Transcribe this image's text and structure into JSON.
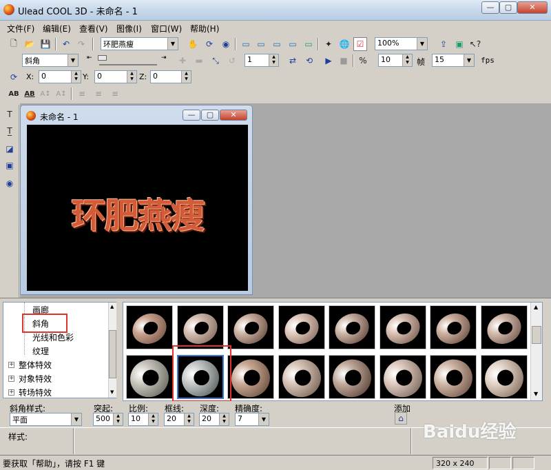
{
  "window": {
    "title": "Ulead COOL 3D - 未命名 - 1",
    "min": "—",
    "max": "▢",
    "close": "✕"
  },
  "menu": [
    "文件(F)",
    "编辑(E)",
    "查看(V)",
    "图像(I)",
    "窗口(W)",
    "帮助(H)"
  ],
  "toolbar1": {
    "object_combo": "环肥燕瘦",
    "zoom": "100%"
  },
  "toolbar2": {
    "effect_combo": "斜角",
    "frame_value": "1",
    "frame_count": "10",
    "frames_label": "帧",
    "fps_value": "15",
    "fps_label": "fps"
  },
  "toolbar3": {
    "x_label": "X:",
    "x_value": "0",
    "y_label": "Y:",
    "y_value": "0",
    "z_label": "Z:",
    "z_value": "0"
  },
  "document": {
    "title": "未命名 - 1",
    "scene_text": "环肥燕瘦"
  },
  "tree": {
    "items": [
      "画廊",
      "斜角",
      "光线和色彩",
      "纹理"
    ],
    "groups": [
      "整体特效",
      "对象特效",
      "转场特效"
    ],
    "selected": "斜角"
  },
  "gallery": {
    "rows": 2,
    "per_row": 8,
    "selected_row": 2,
    "selected_col": 2
  },
  "properties": {
    "bevel_style_label": "斜角样式:",
    "bevel_style_value": "平面",
    "protrude_label": "突起:",
    "protrude_value": "500",
    "ratio_label": "比例:",
    "ratio_value": "10",
    "border_label": "框线:",
    "border_value": "20",
    "depth_label": "深度:",
    "depth_value": "20",
    "precision_label": "精确度:",
    "precision_value": "7",
    "add_label": "添加"
  },
  "style_panel": {
    "label": "样式:"
  },
  "status": {
    "help_text": "要获取「帮助」，请按 F1 键",
    "size": "320 x 240"
  },
  "watermark": "Baidu经验"
}
